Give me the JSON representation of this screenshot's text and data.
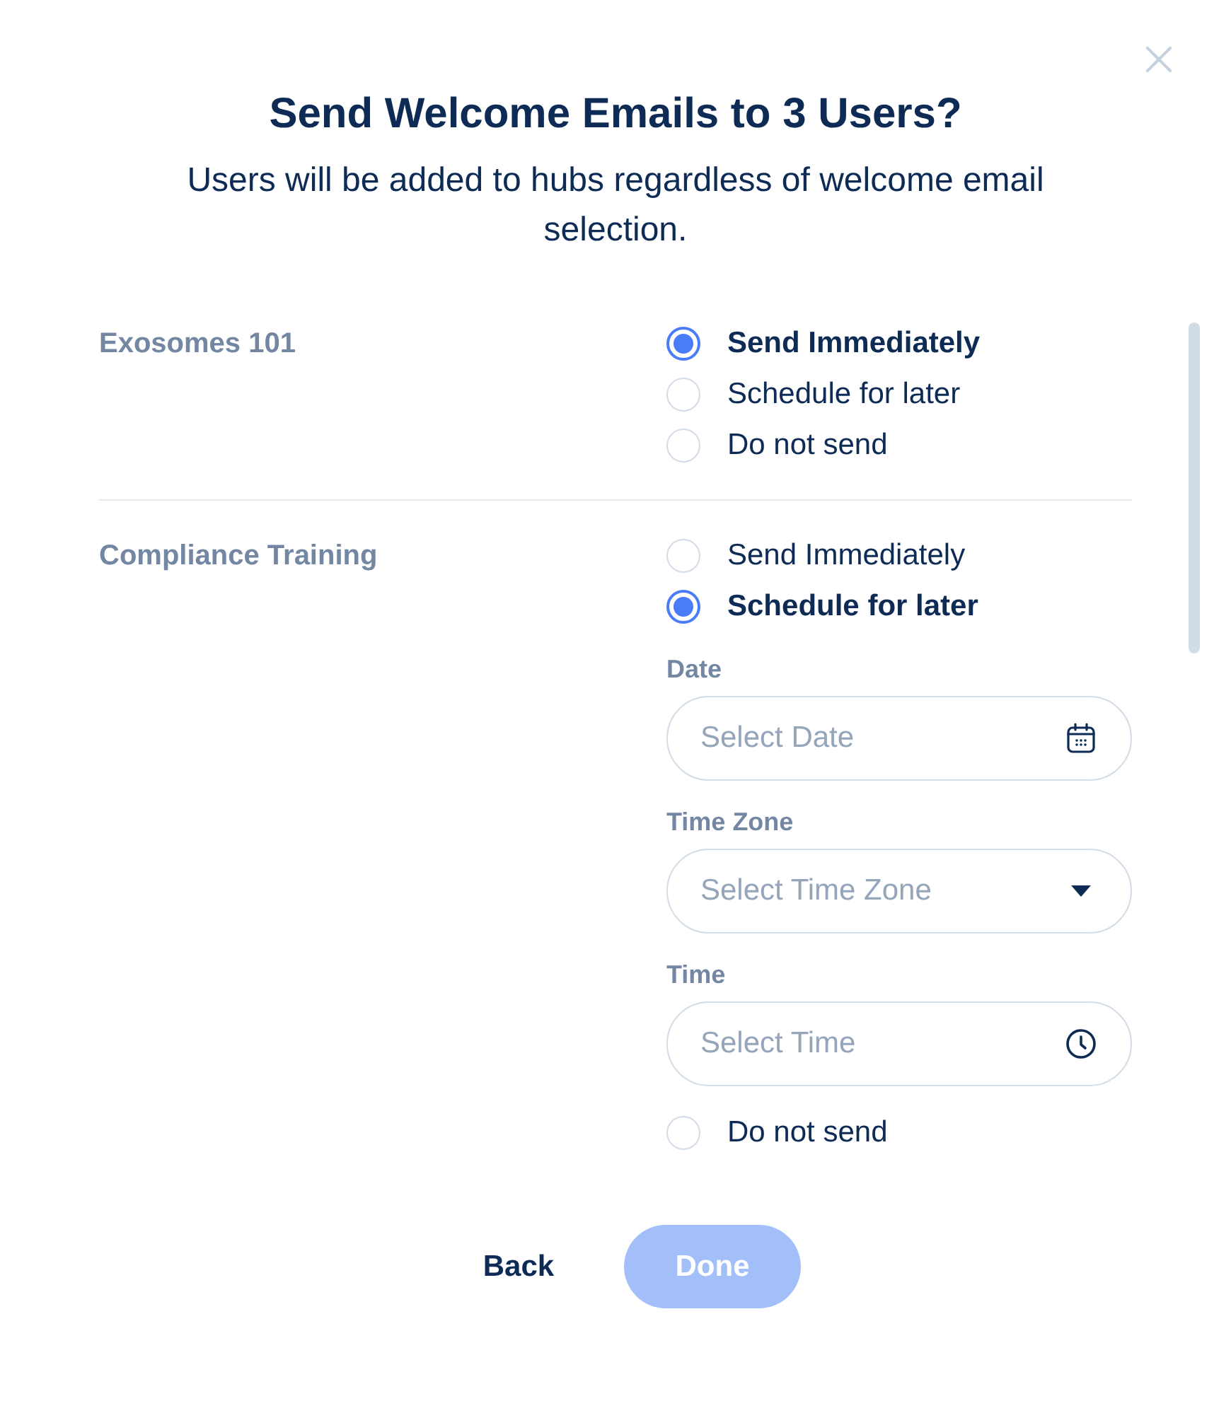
{
  "dialog": {
    "title": "Send Welcome Emails to 3 Users?",
    "subtitle": "Users will be added to hubs regardless of welcome email selection."
  },
  "hubs": [
    {
      "name": "Exosomes 101",
      "options": [
        {
          "label": "Send Immediately",
          "selected": true
        },
        {
          "label": "Schedule for later",
          "selected": false
        },
        {
          "label": "Do not send",
          "selected": false
        }
      ]
    },
    {
      "name": "Compliance Training",
      "options": [
        {
          "label": "Send Immediately",
          "selected": false
        },
        {
          "label": "Schedule for later",
          "selected": true,
          "fields": [
            {
              "kind": "date",
              "label": "Date",
              "placeholder": "Select Date"
            },
            {
              "kind": "select",
              "label": "Time Zone",
              "placeholder": "Select Time Zone"
            },
            {
              "kind": "time",
              "label": "Time",
              "placeholder": "Select Time"
            }
          ]
        },
        {
          "label": "Do not send",
          "selected": false
        }
      ]
    }
  ],
  "buttons": [
    {
      "kind": "text",
      "label": "Back",
      "disabled": false
    },
    {
      "kind": "primary",
      "label": "Done",
      "disabled": true
    }
  ]
}
